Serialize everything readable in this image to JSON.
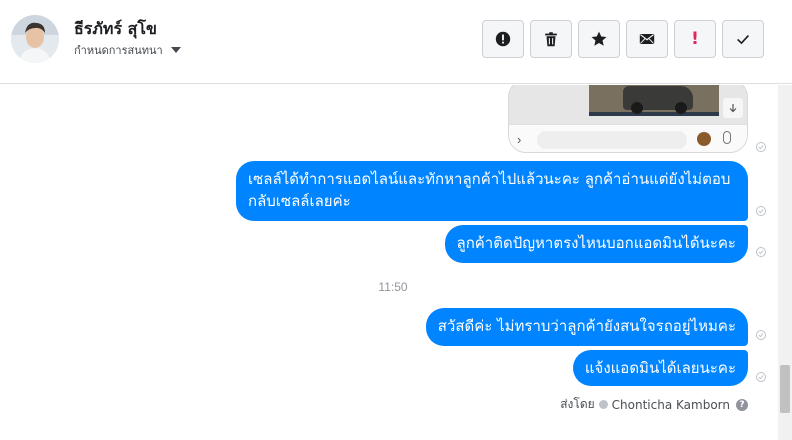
{
  "header": {
    "contact_name": "ธีรภัทร์ สุโข",
    "assign_label": "กำหนดการสนทนา"
  },
  "toolbar": {
    "buttons": [
      {
        "icon": "alert-circle-icon",
        "action": "report"
      },
      {
        "icon": "trash-icon",
        "action": "delete"
      },
      {
        "icon": "star-icon",
        "action": "star"
      },
      {
        "icon": "envelope-icon",
        "action": "mark-unread"
      },
      {
        "icon": "exclamation-icon",
        "action": "mark-important",
        "glyph": "!"
      },
      {
        "icon": "check-icon",
        "action": "mark-done"
      }
    ],
    "accent_red": "#e0245e"
  },
  "messages": [
    {
      "text": "เซลล์ได้ทำการแอดไลน์และทักหาลูกค้าไปแล้วนะคะ ลูกค้าอ่านแต่ยังไม่ตอบกลับเซลล์เลยค่ะ"
    },
    {
      "text": "ลูกค้าติดปัญหาตรงไหนบอกแอดมินได้นะคะ"
    },
    {
      "text": "สวัสดีค่ะ ไม่ทราบว่าลูกค้ายังสนใจรถอยู่ไหมคะ"
    },
    {
      "text": "แจ้งแอดมินได้เลยนะคะ"
    }
  ],
  "timestamp": "11:50",
  "sent_by": {
    "label": "ส่งโดย",
    "name": "Chonticha Kamborn",
    "help": "?"
  },
  "colors": {
    "bubble": "#0084ff",
    "bubble_text": "#ffffff"
  }
}
